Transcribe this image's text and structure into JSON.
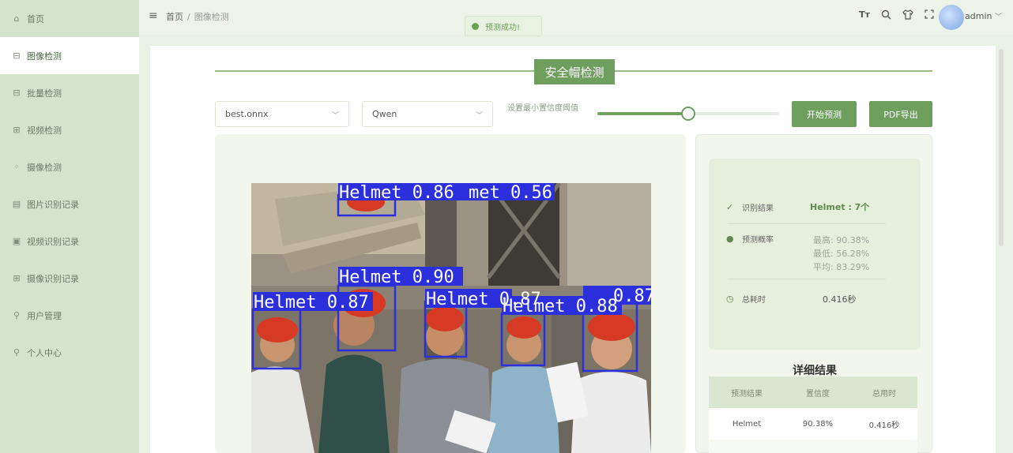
{
  "sidebar": {
    "items": [
      {
        "label": "首页",
        "icon": "⌂"
      },
      {
        "label": "图像检测",
        "icon": "⊟"
      },
      {
        "label": "批量检测",
        "icon": "⊟"
      },
      {
        "label": "视频检测",
        "icon": "⊞"
      },
      {
        "label": "摄像检测",
        "icon": "◦"
      },
      {
        "label": "图片识别记录",
        "icon": "▤"
      },
      {
        "label": "视频识别记录",
        "icon": "▣"
      },
      {
        "label": "摄像识别记录",
        "icon": "⊞"
      },
      {
        "label": "用户管理",
        "icon": "⚲"
      },
      {
        "label": "个人中心",
        "icon": "⚲"
      }
    ],
    "active_index": 1
  },
  "header": {
    "breadcrumb_home": "首页",
    "breadcrumb_sep": "/",
    "breadcrumb_current": "图像检测",
    "username": "admin",
    "icons": [
      "text-size-icon",
      "search-icon",
      "shirt-icon",
      "fullscreen-icon"
    ]
  },
  "toast": {
    "message": "预测成功!",
    "color": "#6aa252"
  },
  "page": {
    "title": "安全帽检测",
    "model_select": "best.onnx",
    "llm_select": "Qwen",
    "conf_label": "设置最小置信度阈值",
    "conf_value": 0.5,
    "btn_predict": "开始预测",
    "btn_pdf": "PDF导出",
    "accent": "#6e9f5f"
  },
  "detections": [
    {
      "label": "Helmet 0.86"
    },
    {
      "label": "met 0.56"
    },
    {
      "label": "Helmet 0.90"
    },
    {
      "label": "Helmet 0.87"
    },
    {
      "label": "Helmet 0.87"
    },
    {
      "label": "Helmet 0.88"
    },
    {
      "label": "0.87"
    }
  ],
  "result": {
    "recog_label": "识别结果",
    "recog_value": "Helmet : 7个",
    "prob_label": "预测概率",
    "prob_max": "最高:  90.38%",
    "prob_min": "最低:  56.28%",
    "prob_avg": "平均:  83.29%",
    "time_label": "总耗时",
    "time_value": "0.416秒"
  },
  "detail": {
    "title": "详细结果",
    "columns": [
      "预测结果",
      "置信度",
      "总用时"
    ],
    "rows": [
      [
        "Helmet",
        "90.38%",
        "0.416秒"
      ]
    ]
  }
}
